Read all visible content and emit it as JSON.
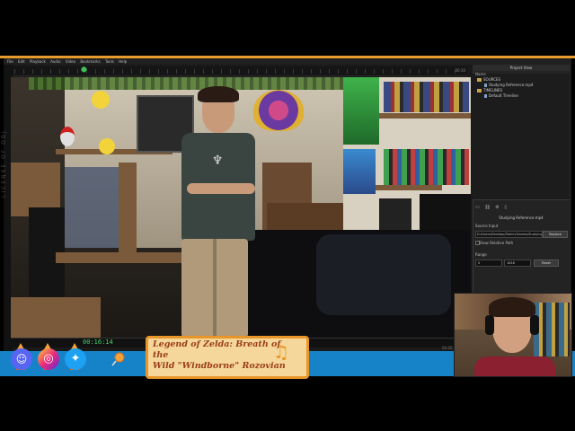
{
  "menubar": {
    "items": [
      "File",
      "Edit",
      "Playback",
      "Audio",
      "Video",
      "Bookmarks",
      "Tools",
      "Help"
    ]
  },
  "left_strip": {
    "text": "LICENSE  OF OBJ"
  },
  "timeline": {
    "top_time": "00:30",
    "current_time": "00:16:14",
    "end_time": "00:00"
  },
  "project_panel": {
    "title": "Project View",
    "column_name": "Name",
    "tree": [
      {
        "label": "SOURCES",
        "kind": "folder",
        "depth": 0
      },
      {
        "label": "Studying Reference.mp4",
        "kind": "file",
        "depth": 1
      },
      {
        "label": "TIMELINES",
        "kind": "folder",
        "depth": 0
      },
      {
        "label": "Default Timeline",
        "kind": "file",
        "depth": 1
      }
    ],
    "toolbar_icons": [
      "folder-add-icon",
      "link-icon",
      "settings-icon",
      "trash-icon"
    ],
    "selected_name": "Studying Reference.mp4",
    "source_input_label": "Source Input",
    "source_input_value": "D:/Users/Desktop/Twitch/Games/Studying Reference.mp4",
    "browse_label": "Replace",
    "show_relative_label": "Show Relative Path",
    "range_label": "Range",
    "range_start": "0",
    "range_end": "1616",
    "reset_label": "Reset"
  },
  "music": {
    "title_line1": "Legend of Zelda: Breath of the",
    "title_line2": "Wild \"Windborne\"  Rozovian"
  },
  "social": [
    {
      "name": "discord",
      "color": "#5865f2"
    },
    {
      "name": "instagram",
      "color": "#ee2a7b"
    },
    {
      "name": "twitter",
      "color": "#1da1f2"
    }
  ],
  "colors": {
    "accent_orange": "#e89a2a",
    "overlay_blue": "#1683c9",
    "timecode_green": "#45d56b"
  }
}
